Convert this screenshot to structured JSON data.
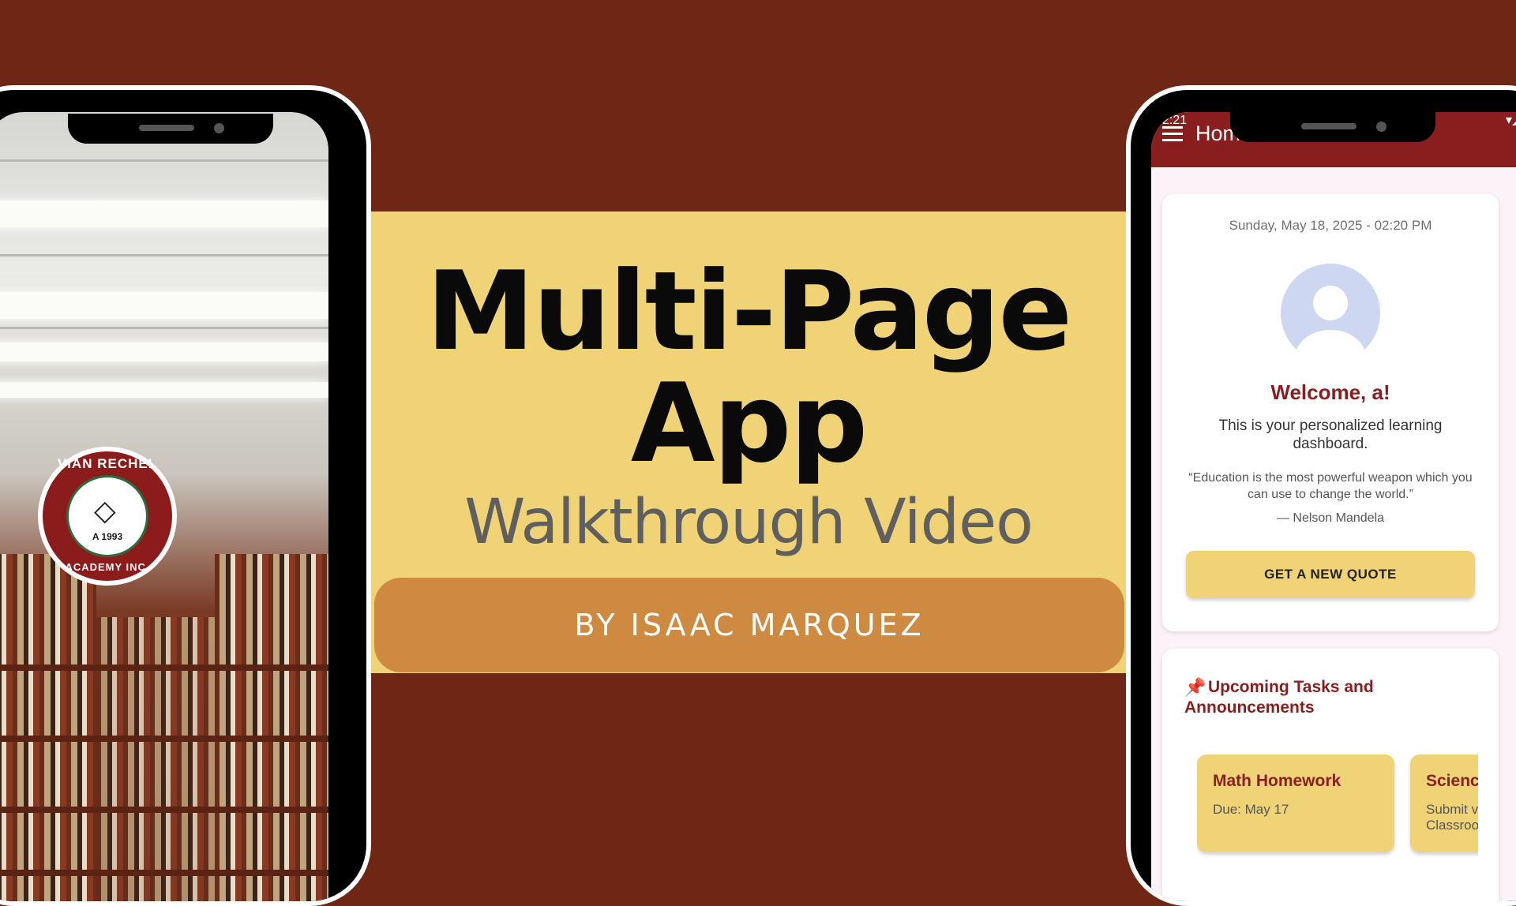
{
  "banner": {
    "title_line1": "Multi-Page",
    "title_line2": "App",
    "subtitle": "Walkthrough Video",
    "byline": "BY ISAAC MARQUEZ"
  },
  "left_phone": {
    "seal": {
      "top_text": "VIAN RECHEL",
      "bottom_text": "ACADEMY INC.",
      "year": "A 1993"
    }
  },
  "right_phone": {
    "status_time": "2:21",
    "app_title": "Home",
    "date_time": "Sunday, May 18, 2025 - 02:20 PM",
    "welcome": "Welcome, a!",
    "description": "This is your personalized learning dashboard.",
    "quote": "“Education is the most powerful weapon which you can use to change the world.”",
    "quote_author": "— Nelson Mandela",
    "quote_button": "GET A NEW QUOTE",
    "tasks_title": "Upcoming Tasks and Announcements",
    "tasks": [
      {
        "title": "Math Homework",
        "detail": "Due: May 17"
      },
      {
        "title": "Science",
        "detail": "Submit via Classroom"
      }
    ]
  },
  "colors": {
    "background": "#702615",
    "banner": "#f0d277",
    "byline": "#cd8a40",
    "app_bar": "#8a1e1e"
  }
}
